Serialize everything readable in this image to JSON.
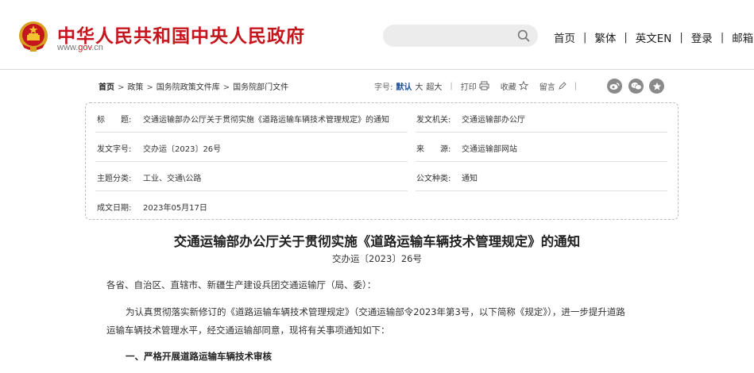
{
  "header": {
    "site_title": "中华人民共和国中央人民政府",
    "site_url_prefix": "www.",
    "site_url_brand": "gov",
    "site_url_suffix": ".cn",
    "search_placeholder": "",
    "nav": [
      "首页",
      "繁体",
      "英文EN",
      "登录",
      "邮箱"
    ],
    "nav_separator": "|",
    "brand_color": "#c5161d"
  },
  "breadcrumb": {
    "items": [
      "首页",
      "政策",
      "国务院政策文件库",
      "国务院部门文件"
    ],
    "separator": ">"
  },
  "toolbar": {
    "font_size_label": "字号:",
    "font_sizes": [
      "默认",
      "大",
      "超大"
    ],
    "active_font_size": "默认",
    "print_label": "打印",
    "favorite_label": "收藏",
    "comment_label": "留言",
    "bar": "|",
    "share_icons": [
      "weibo-icon",
      "wechat-icon",
      "star-icon"
    ]
  },
  "info": {
    "title_key": "标　　题:",
    "title_value": "交通运输部办公厅关于贯彻实施《道路运输车辆技术管理规定》的通知",
    "issuer_key": "发文机关:",
    "issuer_value": "交通运输部办公厅",
    "docno_key": "发文字号:",
    "docno_value": "交办运〔2023〕26号",
    "source_key": "来　　源:",
    "source_value": "交通运输部网站",
    "category_key": "主题分类:",
    "category_value": "工业、交通\\公路",
    "type_key": "公文种类:",
    "type_value": "通知",
    "date_key": "成文日期:",
    "date_value": "2023年05月17日"
  },
  "article": {
    "title": "交通运输部办公厅关于贯彻实施《道路运输车辆技术管理规定》的通知",
    "docno": "交办运〔2023〕26号",
    "salutation": "各省、自治区、直辖市、新疆生产建设兵团交通运输厅（局、委）：",
    "para1_line1": "为认真贯彻落实新修订的《道路运输车辆技术管理规定》（交通运输部令2023年第3号，以下简称《规定》），进一步提升道路",
    "para1_line2": "运输车辆技术管理水平，经交通运输部同意，现将有关事项通知如下：",
    "heading1": "一、严格开展道路运输车辆技术审核"
  }
}
